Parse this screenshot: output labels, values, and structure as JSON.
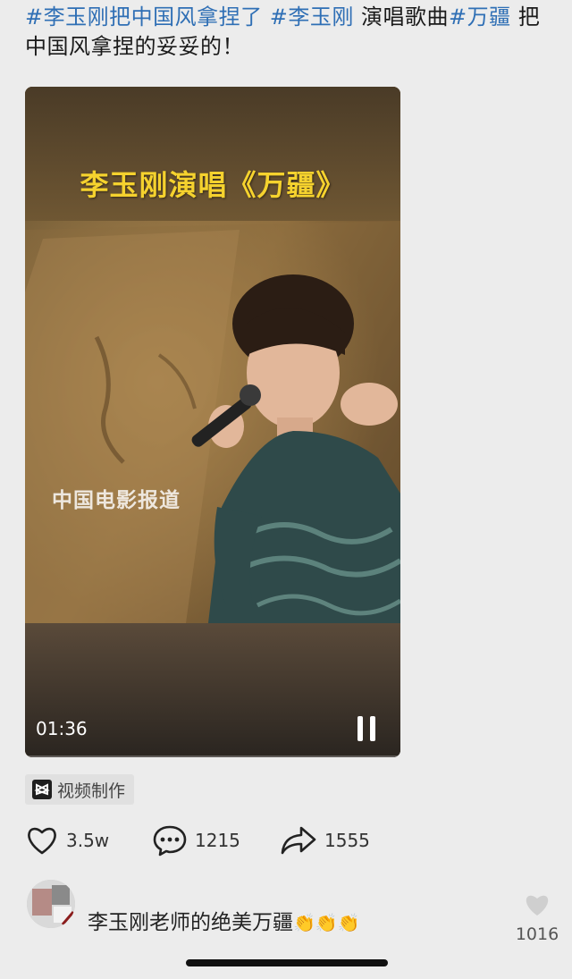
{
  "post": {
    "tag1": "#李玉刚把中国风拿捏了",
    "tag2": "#李玉刚",
    "text1": "演唱歌曲",
    "tag3": "#万疆",
    "text2": "把中国风拿捏的妥妥的！"
  },
  "video": {
    "title": "李玉刚演唱《万疆》",
    "watermark": "中国电影报道",
    "duration": "01:36",
    "control_icon": "pause-icon"
  },
  "made_tag": {
    "label": "视频制作",
    "icon": "capcut-icon"
  },
  "actions": {
    "likes": "3.5w",
    "comments": "1215",
    "shares": "1555"
  },
  "comment": {
    "text": "李玉刚老师的绝美万疆",
    "emojis": "👏👏👏",
    "like_count": "1016"
  },
  "colors": {
    "hashtag": "#2f6fb5",
    "video_title": "#f5d22e",
    "background": "#ececec"
  }
}
